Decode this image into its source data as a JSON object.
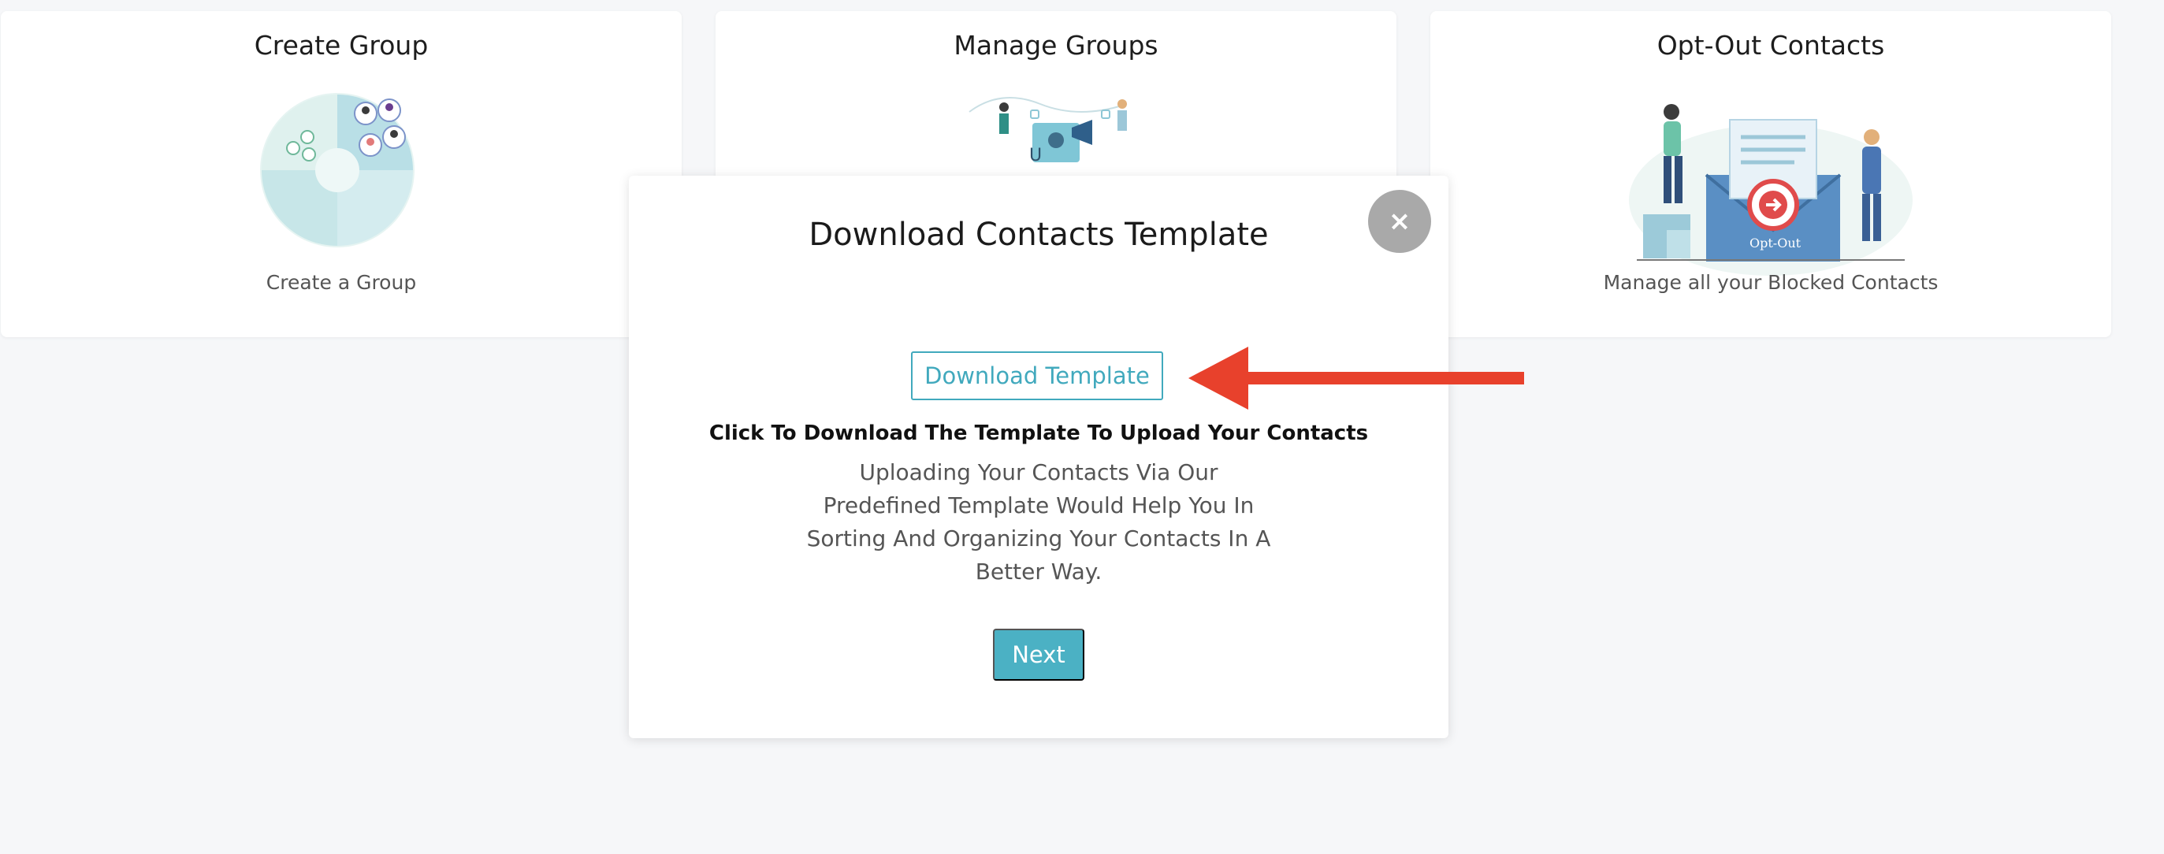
{
  "cards": [
    {
      "title": "Create Group",
      "subtitle": "Create a Group",
      "icon": "group-pie-illustration"
    },
    {
      "title": "Manage Groups",
      "subtitle": "",
      "icon": "manage-groups-illustration"
    },
    {
      "title": "Opt-Out Contacts",
      "subtitle": "Manage all your Blocked Contacts",
      "icon": "opt-out-illustration",
      "badge": "Opt-Out"
    }
  ],
  "modal": {
    "title": "Download Contacts Template",
    "close_label": "×",
    "download_label": "Download Template",
    "instruction": "Click To Download The Template To Upload Your Contacts",
    "description": "Uploading Your Contacts Via Our Predefined Template Would Help You In Sorting And Organizing Your Contacts In A Better Way.",
    "next_label": "Next"
  },
  "colors": {
    "accent": "#41a9bd",
    "next_button": "#4bb1c4",
    "close_button": "#a9a9a9",
    "annotation_arrow": "#e8412c",
    "background": "#f6f7f9"
  }
}
